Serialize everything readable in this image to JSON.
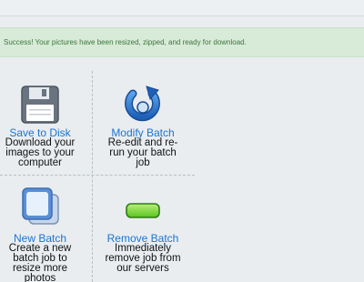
{
  "alert": {
    "message": "Success! Your pictures have been resized, zipped, and ready for download."
  },
  "actions": {
    "save": {
      "title": "Save to Disk",
      "description": "Download your images to your computer",
      "icon": "floppy-disk-icon"
    },
    "modify": {
      "title": "Modify Batch",
      "description": "Re-edit and re-run your batch job",
      "icon": "refresh-icon"
    },
    "new": {
      "title": "New Batch",
      "description": "Create a new batch job to resize more photos",
      "icon": "new-batch-icon"
    },
    "remove": {
      "title": "Remove Batch",
      "description": "Immediately remove job from our servers",
      "icon": "remove-bar-icon"
    }
  },
  "colors": {
    "alert_bg": "#d8ead8",
    "alert_text": "#3c763d",
    "link": "#1b74d4",
    "page_bg": "#e9edf0"
  }
}
